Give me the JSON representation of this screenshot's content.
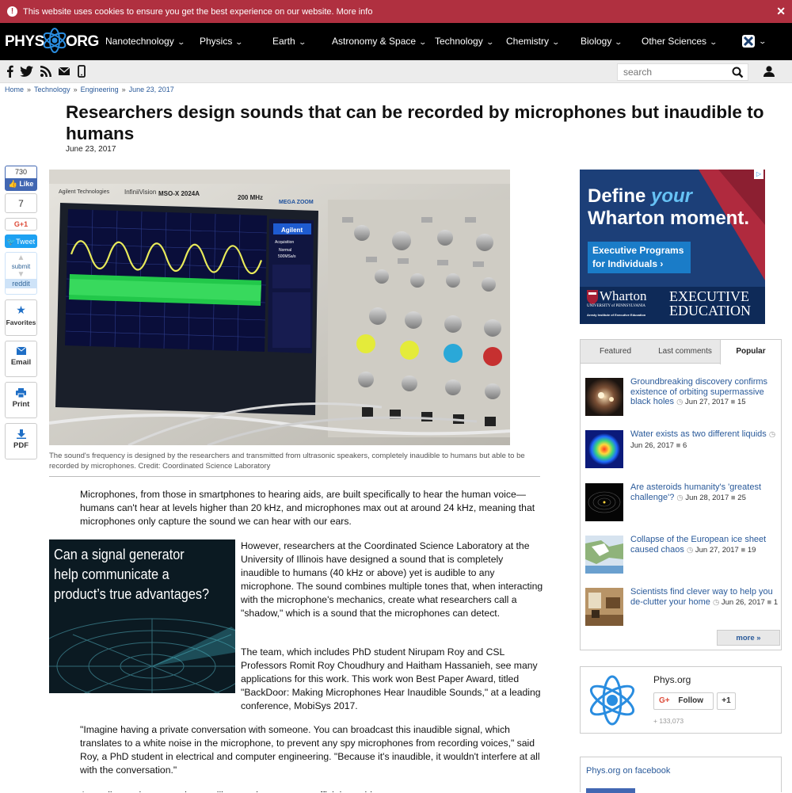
{
  "cookie": {
    "message": "This website uses cookies to ensure you get the best experience on our website.",
    "link": "More info",
    "close": "✕",
    "icon": "!"
  },
  "nav": {
    "logo_left": "PHYS",
    "logo_right": "ORG",
    "items": [
      "Nanotechnology",
      "Physics",
      "Earth",
      "Astronomy & Space",
      "Technology",
      "Chemistry",
      "Biology",
      "Other Sciences"
    ]
  },
  "search": {
    "placeholder": "search"
  },
  "breadcrumb": [
    "Home",
    "Technology",
    "Engineering",
    "June 23, 2017"
  ],
  "article": {
    "title": "Researchers design sounds that can be recorded by microphones but inaudible to humans",
    "date": "June 23, 2017",
    "caption": "The sound's frequency is designed by the researchers and transmitted from ultrasonic speakers, completely inaudible to humans but able to be recorded by microphones. Credit: Coordinated Science Laboratory",
    "p1": "Microphones, from those in smartphones to hearing aids, are built specifically to hear the human voice—humans can't hear at levels higher than 20 kHz, and microphones max out at around 24 kHz, meaning that microphones only capture the sound we can hear with our ears.",
    "p2": "However, researchers at the Coordinated Science Laboratory at the University of Illinois have designed a sound that is completely inaudible to humans (40 kHz or above) yet is audible to any microphone. The sound combines multiple tones that, when interacting with the microphone's mechanics, create what researchers call a \"shadow,\" which is a sound that the microphones can detect.",
    "p3": "The team, which includes PhD student Nirupam Roy and CSL Professors Romit Roy Choudhury and Haitham Hassanieh, see many applications for this work. This work won Best Paper Award, titled \"BackDoor: Making Microphones Hear Inaudible Sounds,\" at a leading conference, MobiSys 2017.",
    "p4": "\"Imagine having a private conversation with someone. You can broadcast this inaudible signal, which translates to a white noise in the microphone, to prevent any spy microphones from recording voices,\" said Roy, a PhD student in electrical and computer engineering. \"Because it's inaudible, it wouldn't interfere at all with the conversation.\"",
    "p5": "According to the researchers, military and government officials could use ..."
  },
  "share": {
    "like_count": "730",
    "like": "Like",
    "gplus_count": "7",
    "gplus": "G+1",
    "tweet": "Tweet",
    "reddit_submit": "submit",
    "reddit": "reddit",
    "favorites": "Favorites",
    "email": "Email",
    "print": "Print",
    "pdf": "PDF"
  },
  "scope": {
    "brand": "Agilent Technologies",
    "model": "InfiniiVision",
    "model_no": "MSO-X 2024A",
    "bandwidth": "200 MHz",
    "panel_title": "Agilent",
    "acq": "Acquisition",
    "mode": "Normal",
    "rate": "500MSa/s",
    "mega": "MEGA ZOOM"
  },
  "ad_signal": {
    "line1": "Can a signal generator",
    "line2": "help communicate a",
    "line3": "product’s true advantages?"
  },
  "ad_wharton": {
    "line1a": "Define ",
    "line1b": "your",
    "line2": "Wharton moment.",
    "btn1": "Executive Programs",
    "btn2": "for Individuals ›",
    "logo": "Wharton",
    "univ": "UNIVERSITY of PENNSYLVANIA",
    "aresty": "Aresty Institute of Executive Education",
    "exec1": "EXECUTIVE",
    "exec2": "EDUCATION",
    "adchoice": "▷"
  },
  "sidebar": {
    "tabs": [
      "Featured",
      "Last comments",
      "Popular"
    ],
    "active_tab": "Popular",
    "popular": [
      {
        "title": "Groundbreaking discovery confirms existence of orbiting supermassive black holes",
        "date": "Jun 27, 2017",
        "comments": "15"
      },
      {
        "title": "Water exists as two different liquids",
        "date": "Jun 26, 2017",
        "comments": "6"
      },
      {
        "title": "Are asteroids humanity's 'greatest challenge'?",
        "date": "Jun 28, 2017",
        "comments": "25"
      },
      {
        "title": "Collapse of the European ice sheet caused chaos",
        "date": "Jun 27, 2017",
        "comments": "19"
      },
      {
        "title": "Scientists find clever way to help you de-clutter your home",
        "date": "Jun 26, 2017",
        "comments": "1"
      }
    ],
    "more": "more »"
  },
  "gplus_box": {
    "name": "Phys.org",
    "follow": "Follow",
    "plus1": "+1",
    "followers": "+ 133,073",
    "g": "G+"
  },
  "facebook_box": {
    "title": "Phys.org on facebook"
  }
}
